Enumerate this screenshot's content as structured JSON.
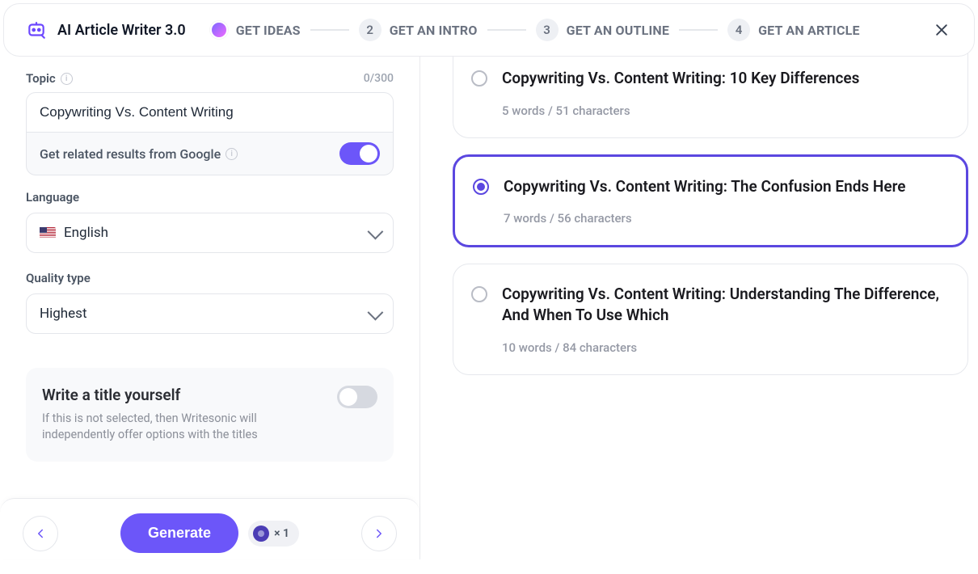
{
  "header": {
    "app_title": "AI Article Writer 3.0",
    "steps": [
      {
        "label": "GET IDEAS",
        "active": true
      },
      {
        "num": "2",
        "label": "GET AN INTRO",
        "active": false
      },
      {
        "num": "3",
        "label": "GET AN OUTLINE",
        "active": false
      },
      {
        "num": "4",
        "label": "GET AN ARTICLE",
        "active": false
      }
    ]
  },
  "left": {
    "topic_label": "Topic",
    "topic_count": "0/300",
    "topic_value": "Copywriting Vs. Content Writing",
    "google_label": "Get related results from Google",
    "google_toggle_on": true,
    "language_label": "Language",
    "language_value": "English",
    "quality_label": "Quality type",
    "quality_value": "Highest",
    "write_title_heading": "Write a title yourself",
    "write_title_desc": "If this is not selected, then Writesonic will independently offer options with the titles",
    "write_title_toggle_on": false
  },
  "footer": {
    "generate_label": "Generate",
    "credit_text": "× 1"
  },
  "results": [
    {
      "title": "Copywriting Vs. Content Writing: 10 Key Differences",
      "meta": "5 words / 51 characters",
      "selected": false,
      "cut_top": true
    },
    {
      "title": "Copywriting Vs. Content Writing: The Confusion Ends Here",
      "meta": "7 words / 56 characters",
      "selected": true,
      "cut_top": false
    },
    {
      "title": "Copywriting Vs. Content Writing: Understanding The Difference, And When To Use Which",
      "meta": "10 words / 84 characters",
      "selected": false,
      "cut_top": false
    }
  ],
  "colors": {
    "accent": "#6c56f9",
    "accent_dark": "#5b47e0"
  }
}
